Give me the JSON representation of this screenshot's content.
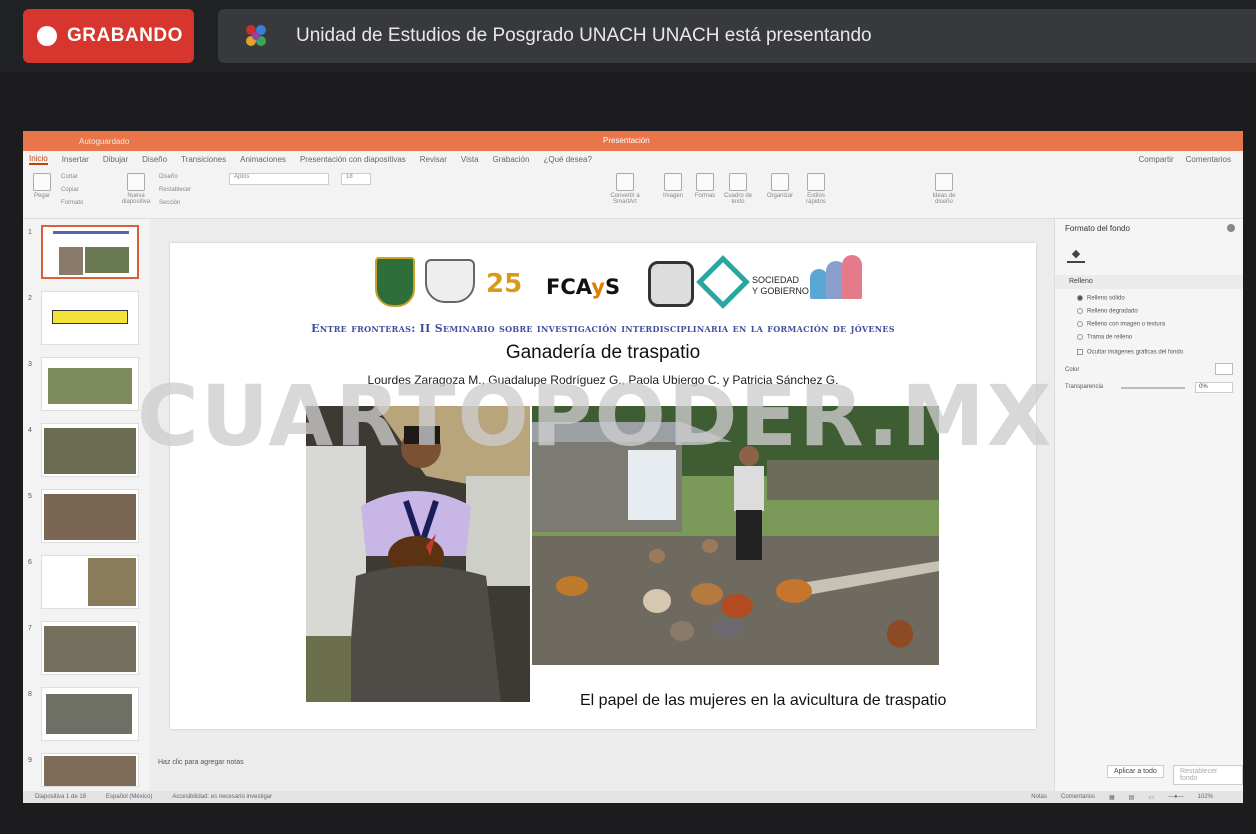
{
  "meeting": {
    "recording_label": "GRABANDO",
    "presenter_text": "Unidad de Estudios de Posgrado UNACH UNACH está presentando"
  },
  "ppt": {
    "titlebar": {
      "autosave": "Autoguardado",
      "doc_title": "Presentación"
    },
    "tabs": [
      "Inicio",
      "Insertar",
      "Dibujar",
      "Diseño",
      "Transiciones",
      "Animaciones",
      "Presentación con diapositivas",
      "Revisar",
      "Vista",
      "Grabación",
      "¿Qué desea?"
    ],
    "tabs_right": [
      "Compartir",
      "Comentarios"
    ],
    "ribbon": {
      "paste": "Pegar",
      "cut": "Cortar",
      "copy": "Copiar",
      "format": "Formato",
      "new_slide": "Nueva diapositiva",
      "layout": "Diseño",
      "reset": "Restablecer",
      "section": "Sección",
      "font": "Aptos",
      "size": "18",
      "convert_smartart": "Convertir a SmartArt",
      "picture": "Imagen",
      "shapes": "Formas",
      "textbox": "Cuadro de texto",
      "arrange": "Organizar",
      "quick_styles": "Estilos rápidos",
      "designer": "Ideas de diseño"
    },
    "slide_numbers": [
      "1",
      "2",
      "3",
      "4",
      "5",
      "6",
      "7",
      "8",
      "9"
    ],
    "slide": {
      "logos": [
        "UNACH",
        "Logo 2",
        "25",
        "FCAyS",
        "CES",
        "SOCIEDAD Y GOBIERNO",
        "Logo 7"
      ],
      "seminar": "Entre fronteras: II Seminario sobre investigación interdisciplinaria en la formación de jóvenes",
      "title": "Ganadería de traspatio",
      "authors": "Lourdes Zaragoza M., Guadalupe Rodríguez G., Paola Ubiergo C. y Patricia Sánchez G.",
      "caption": "El papel de las mujeres en la avicultura de traspatio"
    },
    "notes_placeholder": "Haz clic para agregar notas",
    "format_pane": {
      "title": "Formato del fondo",
      "fill_section": "Relleno",
      "options": [
        "Relleno sólido",
        "Relleno degradado",
        "Relleno con imagen o textura",
        "Trama de relleno"
      ],
      "hide_graphics": "Ocultar imágenes gráficas del fondo",
      "color_label": "Color",
      "transparency_label": "Transparencia",
      "transparency_value": "0%",
      "apply_all": "Aplicar a todo",
      "reset_bg": "Restablecer fondo"
    },
    "statusbar": {
      "slide_info": "Diapositiva 1 de 18",
      "language": "Español (México)",
      "accessibility": "Accesibilidad: es necesario investigar",
      "notes": "Notas",
      "comments": "Comentarios",
      "zoom": "102%"
    }
  },
  "watermark": "CUARTOPODER.MX",
  "colors": {
    "record_red": "#d7362f",
    "ppt_orange": "#e9764b",
    "seminar_blue": "#3e4f9e"
  }
}
